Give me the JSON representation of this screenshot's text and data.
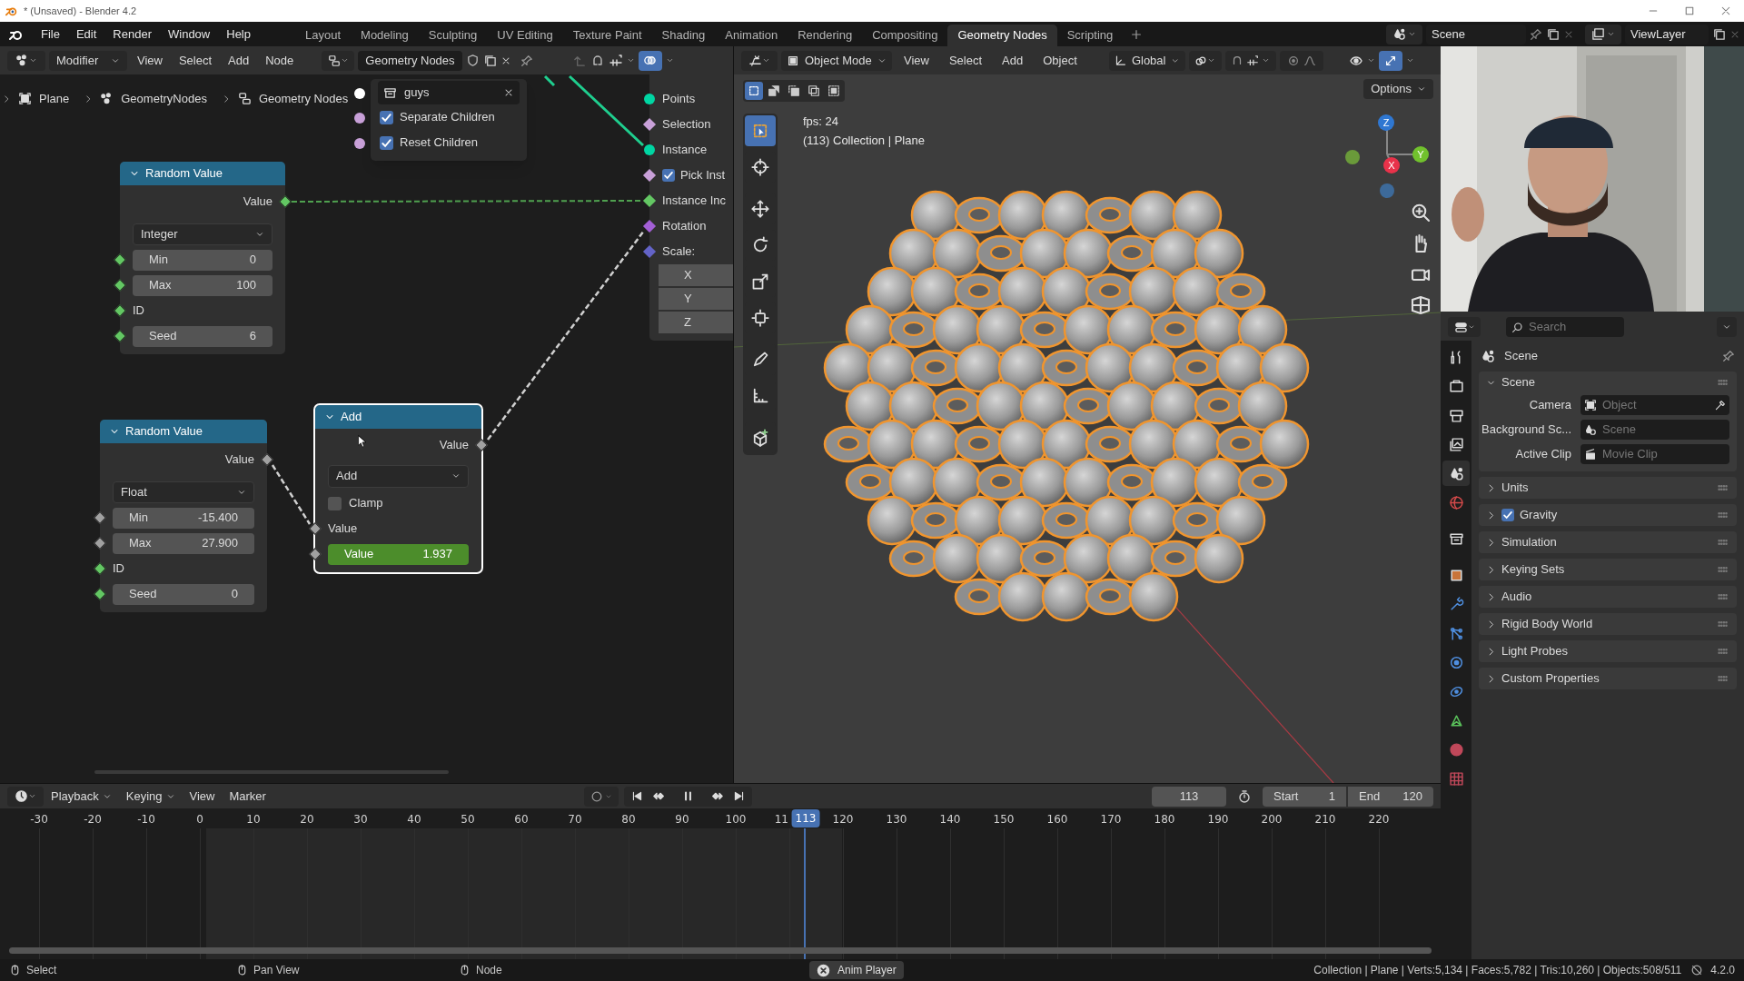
{
  "title_bar": {
    "title": "* (Unsaved) - Blender 4.2"
  },
  "menu": [
    "File",
    "Edit",
    "Render",
    "Window",
    "Help"
  ],
  "workspaces": [
    {
      "label": "Layout",
      "selected": false
    },
    {
      "label": "Modeling",
      "selected": false
    },
    {
      "label": "Sculpting",
      "selected": false
    },
    {
      "label": "UV Editing",
      "selected": false
    },
    {
      "label": "Texture Paint",
      "selected": false
    },
    {
      "label": "Shading",
      "selected": false
    },
    {
      "label": "Animation",
      "selected": false
    },
    {
      "label": "Rendering",
      "selected": false
    },
    {
      "label": "Compositing",
      "selected": false
    },
    {
      "label": "Geometry Nodes",
      "selected": true
    },
    {
      "label": "Scripting",
      "selected": false
    }
  ],
  "scene": "Scene",
  "view_layer": "ViewLayer",
  "node_editor": {
    "mode": "Modifier",
    "menus": [
      "View",
      "Select",
      "Add",
      "Node"
    ],
    "node_tree": "Geometry Nodes",
    "breadcrumbs": [
      "Plane",
      "GeometryNodes",
      "Geometry Nodes"
    ],
    "popup": {
      "name": "guys",
      "options": [
        {
          "label": "Separate Children",
          "checked": true,
          "color": "#c8a0d8"
        },
        {
          "label": "Reset Children",
          "checked": true,
          "color": "#c8a0d8"
        }
      ]
    },
    "partial_node": {
      "sockets": [
        {
          "label": "Points",
          "kind": "geometry",
          "color": "#00d6a3"
        },
        {
          "label": "Selection",
          "kind": "field",
          "color": "#c8a0d8"
        },
        {
          "label": "Instance",
          "kind": "geometry",
          "color": "#00d6a3"
        },
        {
          "label": "Pick Inst",
          "kind": "toggle",
          "checked": true,
          "color": "#c8a0d8"
        },
        {
          "label": "Instance Inc",
          "kind": "field",
          "color": "#63c763"
        },
        {
          "label": "Rotation",
          "kind": "field",
          "color": "#a35fd6"
        },
        {
          "label": "Scale:",
          "kind": "field",
          "color": "#6363c7"
        },
        {
          "label": "X",
          "kind": "component"
        },
        {
          "label": "Y",
          "kind": "component"
        },
        {
          "label": "Z",
          "kind": "component"
        }
      ]
    },
    "nodes": [
      {
        "kind": "random",
        "title": "Random Value",
        "selected": false,
        "output": "Value",
        "type": "Integer",
        "fields": [
          {
            "label": "Min",
            "value": "0",
            "color": "#63c763"
          },
          {
            "label": "Max",
            "value": "100",
            "color": "#63c763"
          }
        ],
        "id_label": "ID",
        "seed": {
          "label": "Seed",
          "value": "6"
        }
      },
      {
        "kind": "random",
        "title": "Random Value",
        "selected": false,
        "output": "Value",
        "type": "Float",
        "fields": [
          {
            "label": "Min",
            "value": "-15.400",
            "color": "#a1a1a1"
          },
          {
            "label": "Max",
            "value": "27.900",
            "color": "#a1a1a1"
          }
        ],
        "id_label": "ID",
        "seed": {
          "label": "Seed",
          "value": "0"
        }
      },
      {
        "kind": "math",
        "title": "Add",
        "selected": true,
        "output": "Value",
        "operation": "Add",
        "clamp": {
          "label": "Clamp",
          "checked": false
        },
        "input_label": "Value",
        "value_field": {
          "label": "Value",
          "value": "1.937"
        }
      }
    ]
  },
  "viewport": {
    "mode": "Object Mode",
    "menus": [
      "View",
      "Select",
      "Add",
      "Object"
    ],
    "orientation": "Global",
    "options": "Options",
    "overlay": [
      "fps: 24",
      "(113) Collection | Plane"
    ],
    "gizmo": [
      "Z",
      "Y",
      "X"
    ]
  },
  "properties": {
    "search": {
      "placeholder": "Search"
    },
    "context": "Scene",
    "tabs": [
      {
        "selected": false
      },
      {
        "selected": false
      },
      {
        "selected": false
      },
      {
        "selected": false
      },
      {
        "selected": true
      },
      {
        "selected": false
      },
      {
        "selected": false
      },
      {
        "selected": false
      },
      {
        "selected": false
      },
      {
        "selected": false
      },
      {
        "selected": false
      },
      {
        "selected": false
      },
      {
        "selected": false
      },
      {
        "selected": false
      },
      {
        "selected": false
      }
    ],
    "panels": [
      {
        "title": "Scene",
        "kind": "plain",
        "expanded": true,
        "rows": [
          {
            "label": "Camera",
            "placeholder": "Object"
          },
          {
            "label": "Background Sc...",
            "placeholder": "Scene"
          },
          {
            "label": "Active Clip",
            "placeholder": "Movie Clip"
          }
        ]
      },
      {
        "title": "Units",
        "kind": "plain",
        "expanded": false
      },
      {
        "title": "Gravity",
        "kind": "toggle",
        "checked": true,
        "expanded": false
      },
      {
        "title": "Simulation",
        "kind": "plain",
        "expanded": false
      },
      {
        "title": "Keying Sets",
        "kind": "plain",
        "expanded": false
      },
      {
        "title": "Audio",
        "kind": "plain",
        "expanded": false
      },
      {
        "title": "Rigid Body World",
        "kind": "plain",
        "expanded": false
      },
      {
        "title": "Light Probes",
        "kind": "plain",
        "expanded": false
      },
      {
        "title": "Custom Properties",
        "kind": "plain",
        "expanded": false
      }
    ]
  },
  "timeline": {
    "menus": [
      "Playback",
      "Keying",
      "View",
      "Marker"
    ],
    "current_frame": "113",
    "start": {
      "label": "Start",
      "value": "1"
    },
    "end": {
      "label": "End",
      "value": "120"
    },
    "ruler": [
      "-30",
      "-20",
      "-10",
      "0",
      "10",
      "20",
      "30",
      "40",
      "50",
      "60",
      "70",
      "80",
      "90",
      "100",
      "11",
      "120",
      "130",
      "140",
      "150",
      "160",
      "170",
      "180",
      "190",
      "200",
      "210",
      "220"
    ],
    "playhead": "113"
  },
  "status_bar": {
    "hints": [
      "Select",
      "Pan View",
      "Node"
    ],
    "badge": "Anim Player",
    "stats": "Collection | Plane | Verts:5,134 | Faces:5,782 | Tris:10,260 | Objects:508/511",
    "version": "4.2.0"
  }
}
